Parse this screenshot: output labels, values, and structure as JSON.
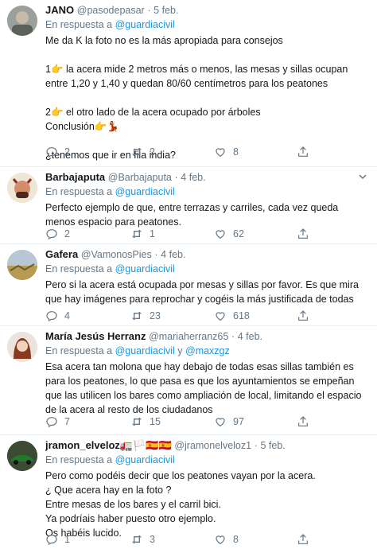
{
  "tweets": [
    {
      "name": "JANO",
      "handle": "@pasodepasar",
      "sep": "·",
      "date": "5 feb.",
      "reply_prefix": "En respuesta a ",
      "reply_to": "@guardiacivil",
      "lines": [
        "Me da K la foto no es la más apropiada para consejos",
        "",
        "1👉  la acera mide 2 metros más o menos, las mesas y sillas ocupan",
        "entre 1,20 y 1,40 y quedan 80/60 centímetros para los peatones",
        "",
        "2👉 el otro lado de la acera ocupado por árboles",
        "Conclusión👉💃",
        "",
        "¿tenemos que ir en fila india?"
      ],
      "replies": "2",
      "retweets": "2",
      "likes": "8"
    },
    {
      "name": "Barbajaputa",
      "handle": "@Barbajaputa",
      "sep": "·",
      "date": "4 feb.",
      "reply_prefix": "En respuesta a ",
      "reply_to": "@guardiacivil",
      "lines": [
        "Perfecto ejemplo de que, entre terrazas y carriles, cada vez queda",
        "menos espacio para peatones."
      ],
      "replies": "2",
      "retweets": "1",
      "likes": "62"
    },
    {
      "name": "Gafera",
      "handle": "@VamonosPies",
      "sep": "·",
      "date": "4 feb.",
      "reply_prefix": "En respuesta a ",
      "reply_to": "@guardiacivil",
      "lines": [
        "Pero si la acera está ocupada por mesas y sillas por favor. Es que mira",
        "que hay imágenes para reprochar y cogéis la más justificada de todas"
      ],
      "replies": "4",
      "retweets": "23",
      "likes": "618"
    },
    {
      "name": "María Jesús Herranz",
      "handle": "@mariaherranz65",
      "sep": "·",
      "date": "4 feb.",
      "reply_prefix": "En respuesta a ",
      "reply_to": "@guardiacivil",
      "reply_and": " y ",
      "reply_to2": "@maxzgz",
      "lines": [
        "Esa acera tan molona que hay debajo de todas esas sillas también es",
        "para los peatones, lo que pasa es que los ayuntamientos se empeñan",
        "que las utilicen los bares como ampliación de local, limitando el espacio",
        "de la acera al resto de los ciudadanos"
      ],
      "replies": "7",
      "retweets": "15",
      "likes": "97"
    },
    {
      "name": "jramon_elveloz🚛🏳️🇪🇸🇪🇸",
      "handle": "@jramonelveloz1",
      "sep": "·",
      "date": "5 feb.",
      "reply_prefix": "En respuesta a ",
      "reply_to": "@guardiacivil",
      "lines": [
        "Pero como podéis decir que los peatones vayan por la acera.",
        "¿ Que acera hay en la foto ?",
        "Entre mesas de los bares y el carril bici.",
        "Ya podríais haber puesto otro ejemplo.",
        "Os habéis lucido."
      ],
      "replies": "1",
      "retweets": "3",
      "likes": "8"
    }
  ],
  "icons": {
    "reply": "reply-icon",
    "retweet": "retweet-icon",
    "like": "heart-icon",
    "share": "share-icon",
    "caret": "chevron-down-icon"
  },
  "colors": {
    "text": "#14171a",
    "muted": "#657786",
    "link": "#1b95e0",
    "divider": "#e6ecf0"
  }
}
